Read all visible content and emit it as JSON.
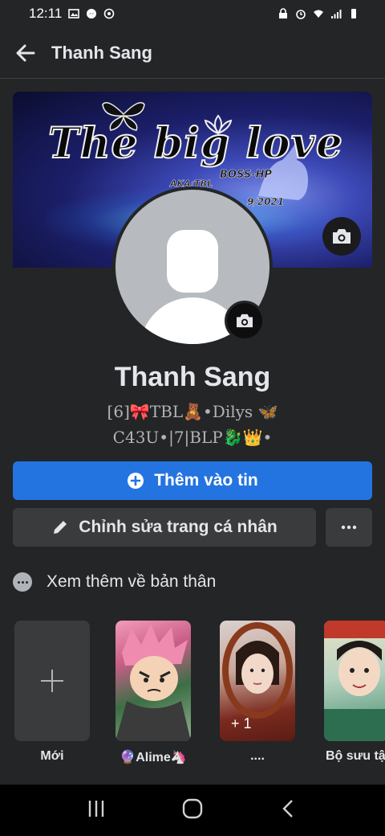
{
  "status_bar": {
    "time": "12:11"
  },
  "header": {
    "title": "Thanh Sang"
  },
  "cover": {
    "title": "The big love",
    "tag_boss": "BOSS-HP",
    "tag_left": "AKA:TBL",
    "tag_date": "9/2021"
  },
  "profile": {
    "name": "Thanh Sang",
    "bio_line1": "[6]🎀TBL🧸•Dilys 🦋",
    "bio_line2": "C43U•|7|BLP🐉👑•"
  },
  "actions": {
    "add_story_label": "Thêm vào tin",
    "edit_profile_label": "Chỉnh sửa trang cá nhân",
    "see_more_label": "Xem thêm về bản thân"
  },
  "highlights": [
    {
      "label": "Mới"
    },
    {
      "label": "🔮Alime🦄"
    },
    {
      "label": "....",
      "overlay": "+ 1"
    },
    {
      "label": "Bộ sưu tậ"
    }
  ],
  "colors": {
    "background": "#242526",
    "primary_button": "#2374e1",
    "secondary_button": "#3a3b3c",
    "text": "#e4e6eb"
  },
  "icons": [
    "back-arrow-icon",
    "camera-icon",
    "plus-circle-icon",
    "pencil-icon",
    "more-icon",
    "nav-recents-icon",
    "nav-home-icon",
    "nav-back-icon"
  ]
}
